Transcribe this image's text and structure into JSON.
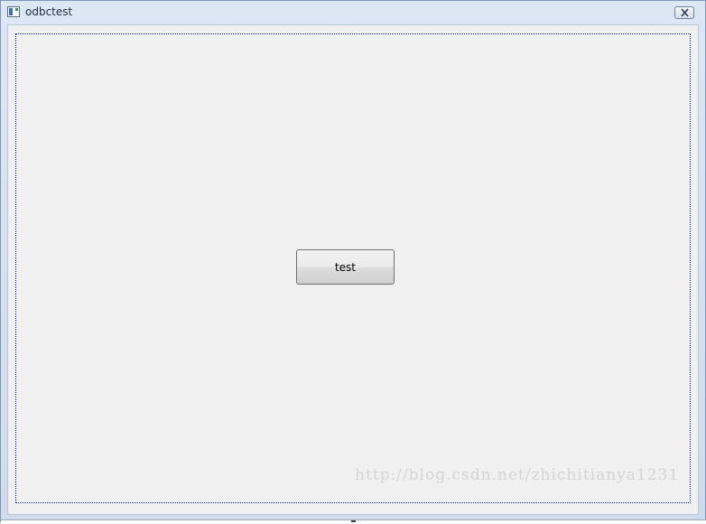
{
  "window": {
    "title": "odbctest",
    "app_icon": "window-app-icon",
    "close_icon": "close-icon"
  },
  "main": {
    "button_label": "test"
  },
  "watermark": "http://blog.csdn.net/zhichitianya1231",
  "colors": {
    "client_background": "#f0f0f0",
    "focus_border": "#1c1ca0",
    "titlebar": "#dce7f4"
  }
}
